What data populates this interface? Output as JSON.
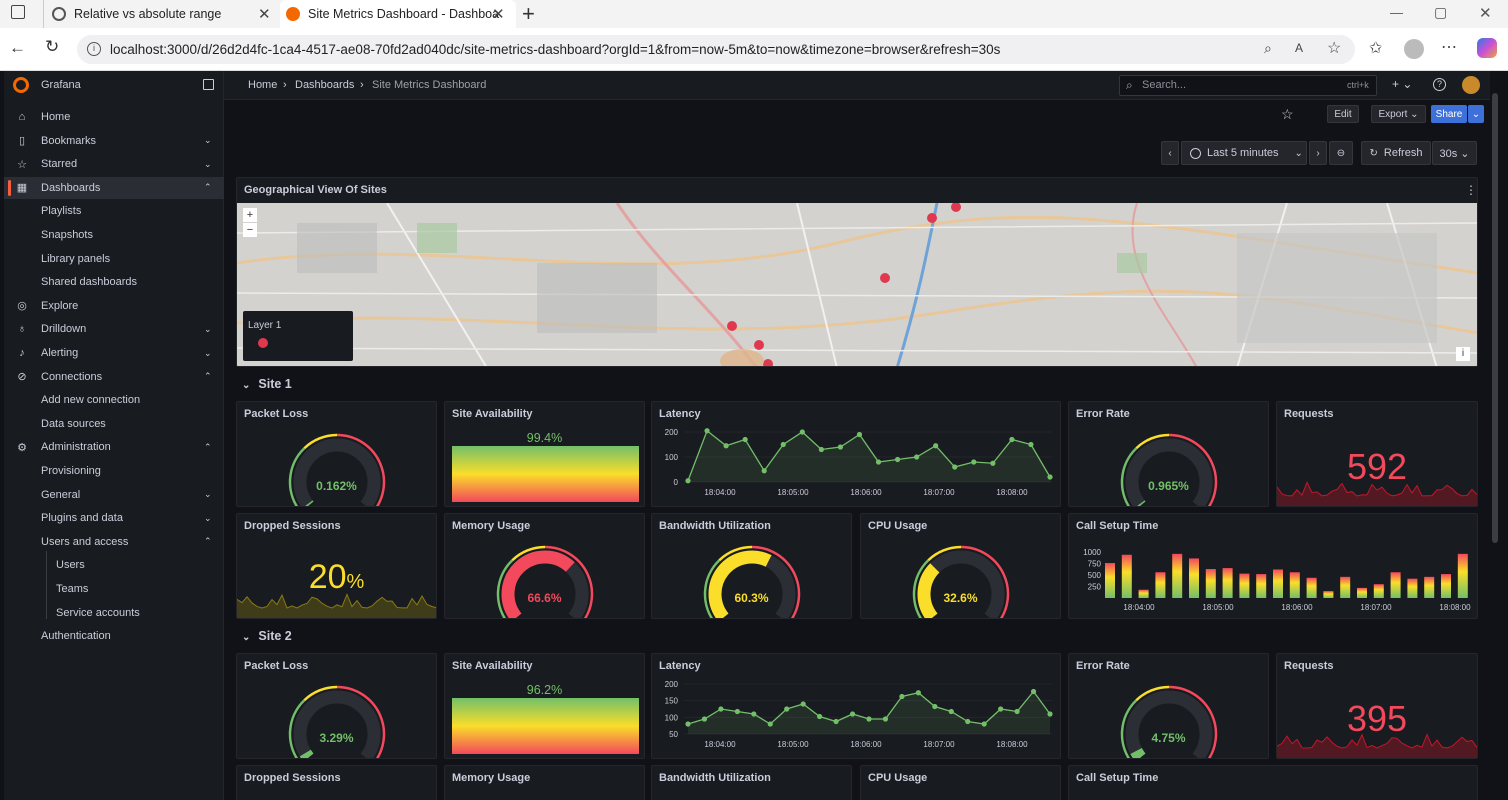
{
  "browser": {
    "tabs": [
      {
        "title": "Relative vs absolute range",
        "close": "✕"
      },
      {
        "title": "Site Metrics Dashboard - Dashboa",
        "close": "✕"
      }
    ],
    "new_tab": "+",
    "url": "localhost:3000/d/26d2d4fc-1ca4-4517-ae08-70fd2ad040dc/site-metrics-dashboard?orgId=1&from=now-5m&to=now&timezone=browser&refresh=30s",
    "window_controls": [
      "—",
      "▢",
      "✕"
    ]
  },
  "sidebar": {
    "brand": "Grafana",
    "items": [
      {
        "label": "Home",
        "icon": "home-icon",
        "glyph": "⌂",
        "chevron": ""
      },
      {
        "label": "Bookmarks",
        "icon": "bookmark-icon",
        "glyph": "▯",
        "chevron": "⌄"
      },
      {
        "label": "Starred",
        "icon": "star-icon",
        "glyph": "☆",
        "chevron": "⌄"
      },
      {
        "label": "Dashboards",
        "icon": "apps-icon",
        "glyph": "▦",
        "chevron": "⌃",
        "active": true
      },
      {
        "label": "Playlists",
        "sub": 1
      },
      {
        "label": "Snapshots",
        "sub": 1
      },
      {
        "label": "Library panels",
        "sub": 1
      },
      {
        "label": "Shared dashboards",
        "sub": 1
      },
      {
        "label": "Explore",
        "icon": "compass-icon",
        "glyph": "◎",
        "chevron": ""
      },
      {
        "label": "Drilldown",
        "icon": "drilldown-icon",
        "glyph": "♁",
        "chevron": "⌄"
      },
      {
        "label": "Alerting",
        "icon": "bell-icon",
        "glyph": "♪",
        "chevron": "⌄"
      },
      {
        "label": "Connections",
        "icon": "connections-icon",
        "glyph": "⊘",
        "chevron": "⌃"
      },
      {
        "label": "Add new connection",
        "sub": 1
      },
      {
        "label": "Data sources",
        "sub": 1
      },
      {
        "label": "Administration",
        "icon": "cog-icon",
        "glyph": "⚙",
        "chevron": "⌃"
      },
      {
        "label": "Provisioning",
        "sub": 1
      },
      {
        "label": "General",
        "sub": 1,
        "chevron": "⌄"
      },
      {
        "label": "Plugins and data",
        "sub": 1,
        "chevron": "⌄"
      },
      {
        "label": "Users and access",
        "sub": 1,
        "chevron": "⌃"
      },
      {
        "label": "Users",
        "sub": 2
      },
      {
        "label": "Teams",
        "sub": 2
      },
      {
        "label": "Service accounts",
        "sub": 2
      },
      {
        "label": "Authentication",
        "sub": 1
      }
    ]
  },
  "topbar": {
    "breadcrumbs": [
      "Home",
      "Dashboards",
      "Site Metrics Dashboard"
    ],
    "search_placeholder": "Search...",
    "search_shortcut": "ctrl+k",
    "plus": "+ ⌄"
  },
  "toolbar": {
    "edit": "Edit",
    "export": "Export ⌄",
    "share": "Share",
    "time_range": "Last 5 minutes",
    "refresh": "Refresh",
    "refresh_interval": "30s ⌄"
  },
  "map_panel": {
    "title": "Geographical View Of Sites",
    "legend_title": "Layer 1",
    "zoom_in": "+",
    "zoom_out": "−",
    "info": "i"
  },
  "sites": [
    {
      "title": "Site 1",
      "panels": {
        "packet_loss": {
          "title": "Packet Loss",
          "value": "0.162%",
          "fraction": 0.0016
        },
        "availability": {
          "title": "Site Availability",
          "value": "99.4%"
        },
        "latency": {
          "title": "Latency",
          "yticks": [
            "200",
            "100",
            "0"
          ],
          "xticks": [
            "18:04:00",
            "18:05:00",
            "18:06:00",
            "18:07:00",
            "18:08:00"
          ]
        },
        "error_rate": {
          "title": "Error Rate",
          "value": "0.965%",
          "fraction": 0.01
        },
        "requests": {
          "title": "Requests",
          "value": "592"
        },
        "dropped": {
          "title": "Dropped Sessions",
          "value": "20",
          "unit": "%"
        },
        "memory": {
          "title": "Memory Usage",
          "value": "66.6%",
          "fraction": 0.666
        },
        "bandwidth": {
          "title": "Bandwidth Utilization",
          "value": "60.3%",
          "fraction": 0.603
        },
        "cpu": {
          "title": "CPU Usage",
          "value": "32.6%",
          "fraction": 0.326
        },
        "call_setup": {
          "title": "Call Setup Time",
          "yticks": [
            "1000",
            "750",
            "500",
            "250"
          ],
          "xticks": [
            "18:04:00",
            "18:05:00",
            "18:06:00",
            "18:07:00",
            "18:08:00"
          ]
        }
      }
    },
    {
      "title": "Site 2",
      "panels": {
        "packet_loss": {
          "title": "Packet Loss",
          "value": "3.29%",
          "fraction": 0.033
        },
        "availability": {
          "title": "Site Availability",
          "value": "96.2%"
        },
        "latency": {
          "title": "Latency",
          "yticks": [
            "200",
            "150",
            "100",
            "50"
          ],
          "xticks": [
            "18:04:00",
            "18:05:00",
            "18:06:00",
            "18:07:00",
            "18:08:00"
          ]
        },
        "error_rate": {
          "title": "Error Rate",
          "value": "4.75%",
          "fraction": 0.0475
        },
        "requests": {
          "title": "Requests",
          "value": "395"
        },
        "dropped": {
          "title": "Dropped Sessions"
        },
        "memory": {
          "title": "Memory Usage"
        },
        "bandwidth": {
          "title": "Bandwidth Utilization"
        },
        "cpu": {
          "title": "CPU Usage"
        },
        "call_setup": {
          "title": "Call Setup Time"
        }
      }
    }
  ],
  "chart_data": [
    {
      "type": "line",
      "title": "Latency",
      "series": [
        {
          "values": [
            5,
            205,
            145,
            170,
            45,
            150,
            200,
            130,
            140,
            190,
            80,
            90,
            100,
            145,
            60,
            80,
            75,
            170,
            150,
            20
          ]
        }
      ],
      "ylim": [
        0,
        200
      ]
    },
    {
      "type": "bar",
      "title": "Call Setup Time",
      "series": [
        {
          "values": [
            760,
            940,
            180,
            560,
            960,
            860,
            630,
            650,
            530,
            520,
            620,
            560,
            440,
            150,
            460,
            220,
            300,
            560,
            420,
            460,
            520,
            960
          ]
        }
      ],
      "ylim": [
        0,
        1000
      ]
    },
    {
      "type": "line",
      "title": "Latency",
      "series": [
        {
          "values": [
            40,
            60,
            100,
            90,
            80,
            40,
            100,
            120,
            70,
            50,
            80,
            60,
            60,
            150,
            165,
            110,
            90,
            50,
            40,
            100,
            90,
            170,
            80
          ]
        }
      ],
      "ylim": [
        0,
        200
      ]
    }
  ],
  "colors": {
    "green": "#73bf69",
    "yellow": "#fade2a",
    "red": "#f2495c",
    "bg": "#111217",
    "panel": "#181b1f"
  }
}
